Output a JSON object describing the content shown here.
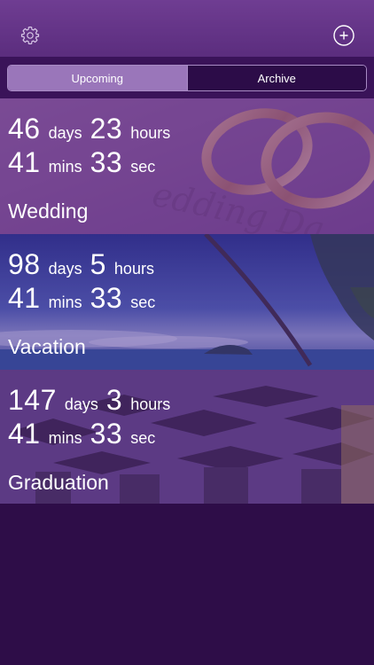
{
  "tabs": {
    "upcoming": "Upcoming",
    "archive": "Archive"
  },
  "events": [
    {
      "days": "46",
      "days_unit": "days",
      "hours": "23",
      "hours_unit": "hours",
      "mins": "41",
      "mins_unit": "mins",
      "secs": "33",
      "secs_unit": "sec",
      "name": "Wedding"
    },
    {
      "days": "98",
      "days_unit": "days",
      "hours": "5",
      "hours_unit": "hours",
      "mins": "41",
      "mins_unit": "mins",
      "secs": "33",
      "secs_unit": "sec",
      "name": "Vacation"
    },
    {
      "days": "147",
      "days_unit": "days",
      "hours": "3",
      "hours_unit": "hours",
      "mins": "41",
      "mins_unit": "mins",
      "secs": "33",
      "secs_unit": "sec",
      "name": "Graduation"
    }
  ],
  "icons": {
    "settings": "gear-icon",
    "add": "plus-circle-icon"
  },
  "colors": {
    "nav": "#5b2d7e",
    "segment_active": "#9a76ba",
    "background": "#2e0d48"
  }
}
